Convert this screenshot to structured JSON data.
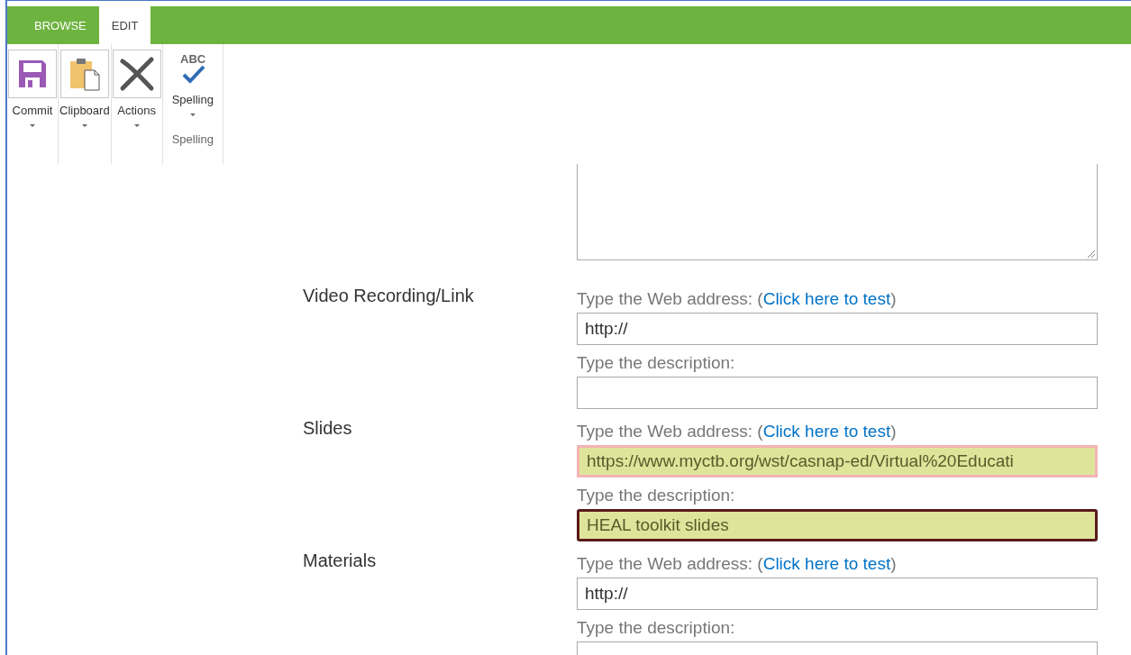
{
  "tabs": [
    {
      "label": "BROWSE",
      "selected": false
    },
    {
      "label": "EDIT",
      "selected": true
    }
  ],
  "ribbon": {
    "buttons": [
      {
        "kind": "save",
        "label": "Commit"
      },
      {
        "kind": "clipboard",
        "label": "Clipboard"
      },
      {
        "kind": "delete",
        "label": "Actions"
      },
      {
        "kind": "spelling",
        "label": "Spelling",
        "icon_text": "ABC"
      }
    ],
    "group_label": "Spelling"
  },
  "form": {
    "rows": [
      {
        "label": "Video Recording/Link",
        "address_prompt": "Type the Web address: (",
        "test_link": "Click here to test",
        "address_close": ")",
        "url": {
          "value": "http://",
          "highlighted": false,
          "focused": false
        },
        "description_prompt": "Type the description:",
        "description": {
          "highlighted": false,
          "focused": false
        }
      },
      {
        "label": "Slides",
        "address_prompt": "Type the Web address: (",
        "test_link": "Click here to test",
        "address_close": ")",
        "url": {
          "value": "https://www.myctb.org/wst/casnap-ed/Virtual%20Educati",
          "highlighted": true,
          "focused": false
        },
        "description_prompt": "Type the description:",
        "description": {
          "value": "HEAL toolkit slides",
          "highlighted": true,
          "focused": true
        }
      },
      {
        "label": "Materials",
        "address_prompt": "Type the Web address: (",
        "test_link": "Click here to test",
        "address_close": ")",
        "url": {
          "value": "http://",
          "highlighted": false,
          "focused": false
        },
        "description_prompt": "Type the description:",
        "description": {
          "highlighted": false,
          "focused": false
        }
      }
    ]
  }
}
